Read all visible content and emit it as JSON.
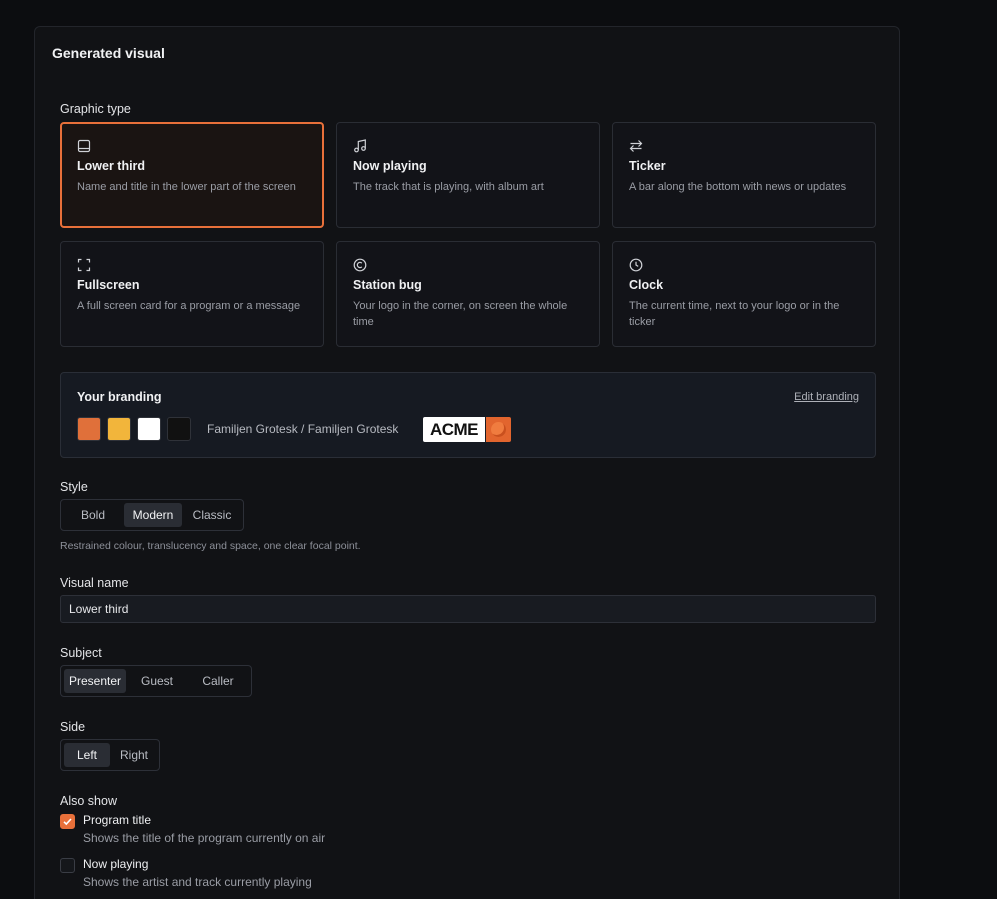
{
  "panel": {
    "title": "Generated visual"
  },
  "graphic_type": {
    "label": "Graphic type",
    "options": [
      {
        "title": "Lower third",
        "desc": "Name and title in the lower part of the screen",
        "icon": "lower-third-icon",
        "selected": true
      },
      {
        "title": "Now playing",
        "desc": "The track that is playing, with album art",
        "icon": "music-note-icon"
      },
      {
        "title": "Ticker",
        "desc": "A bar along the bottom with news or updates",
        "icon": "arrows-swap-icon"
      },
      {
        "title": "Fullscreen",
        "desc": "A full screen card for a program or a message",
        "icon": "fullscreen-icon"
      },
      {
        "title": "Station bug",
        "desc": "Your logo in the corner, on screen the whole time",
        "icon": "copyright-icon"
      },
      {
        "title": "Clock",
        "desc": "The current time, next to your logo or in the ticker",
        "icon": "clock-icon"
      }
    ]
  },
  "branding": {
    "title": "Your branding",
    "edit_label": "Edit branding",
    "colors": [
      "#e0703a",
      "#f2b53b",
      "#ffffff",
      "#111111"
    ],
    "fonts": "Familjen Grotesk / Familjen Grotesk",
    "logo_text": "ACME",
    "accent": "#e8703a"
  },
  "style": {
    "label": "Style",
    "options": [
      "Bold",
      "Modern",
      "Classic"
    ],
    "selected": "Modern",
    "hint": "Restrained colour, translucency and space, one clear focal point."
  },
  "visual_name": {
    "label": "Visual name",
    "value": "Lower third"
  },
  "subject": {
    "label": "Subject",
    "options": [
      "Presenter",
      "Guest",
      "Caller"
    ],
    "selected": "Presenter"
  },
  "side": {
    "label": "Side",
    "options": [
      "Left",
      "Right"
    ],
    "selected": "Left"
  },
  "also_show": {
    "label": "Also show",
    "items": [
      {
        "title": "Program title",
        "desc": "Shows the title of the program currently on air",
        "checked": true
      },
      {
        "title": "Now playing",
        "desc": "Shows the artist and track currently playing",
        "checked": false
      }
    ]
  }
}
